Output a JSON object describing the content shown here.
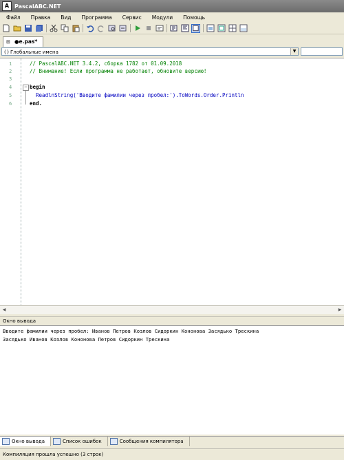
{
  "window": {
    "title": "PascalABC.NET",
    "icon_text": "A"
  },
  "menu": [
    "Файл",
    "Правка",
    "Вид",
    "Программа",
    "Сервис",
    "Модули",
    "Помощь"
  ],
  "toolbar": [
    "new-file-icon",
    "open-folder-icon",
    "save-icon",
    "save-all-icon",
    "cut-icon",
    "copy-icon",
    "paste-icon",
    "undo-icon",
    "redo-icon",
    "find-icon",
    "replace-icon",
    "run-icon",
    "stop-icon",
    "step-icon",
    "debug-icon",
    "format-icon",
    "toggle-icon",
    "windows-icon",
    "help-icon"
  ],
  "tab": {
    "label": "●e.pas*"
  },
  "namespace_combo": {
    "value": "Глобальные имена"
  },
  "editor": {
    "line_numbers": [
      "1",
      "2",
      "3",
      "4",
      "5",
      "6"
    ],
    "lines": [
      "// PascalABC.NET 3.4.2, сборка 1782 от 01.09.2018",
      "// Внимание! Если программа не работает, обновите версию!",
      "",
      "begin",
      "  ReadlnString('Вводите фамилии через пробел:').ToWords.Order.Println",
      "end."
    ]
  },
  "output": {
    "title": "Окно вывода",
    "lines": [
      "Вводите фамилии через пробел: Иванов Петров Козлов Сидоркин Кононoва Засядько Трескина",
      "Засядько Иванов Козлов Кононова Петров Сидоркин Трескина"
    ]
  },
  "bottom_tabs": [
    "Окно вывода",
    "Список ошибок",
    "Сообщения компилятора"
  ],
  "status": "Компиляция прошла успешно (3 строк)"
}
